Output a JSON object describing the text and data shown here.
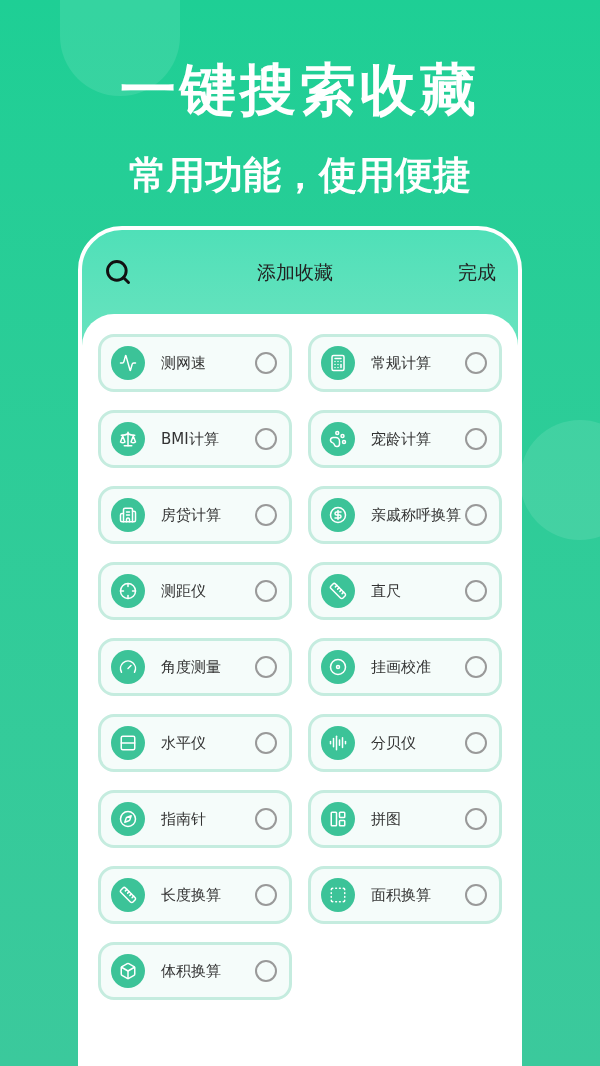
{
  "headline": "一键搜索收藏",
  "subheadline": "常用功能，使用便捷",
  "phone": {
    "title": "添加收藏",
    "done": "完成",
    "items": [
      {
        "label": "测网速",
        "selected": false
      },
      {
        "label": "常规计算",
        "selected": false
      },
      {
        "label": "BMI计算",
        "selected": false
      },
      {
        "label": "宠龄计算",
        "selected": false
      },
      {
        "label": "房贷计算",
        "selected": false
      },
      {
        "label": "亲戚称呼换算",
        "selected": false
      },
      {
        "label": "测距仪",
        "selected": false
      },
      {
        "label": "直尺",
        "selected": false
      },
      {
        "label": "角度测量",
        "selected": false
      },
      {
        "label": "挂画校准",
        "selected": false
      },
      {
        "label": "水平仪",
        "selected": false
      },
      {
        "label": "分贝仪",
        "selected": false
      },
      {
        "label": "指南针",
        "selected": false
      },
      {
        "label": "拼图",
        "selected": false
      },
      {
        "label": "长度换算",
        "selected": false
      },
      {
        "label": "面积换算",
        "selected": false
      },
      {
        "label": "体积换算",
        "selected": false
      }
    ]
  }
}
